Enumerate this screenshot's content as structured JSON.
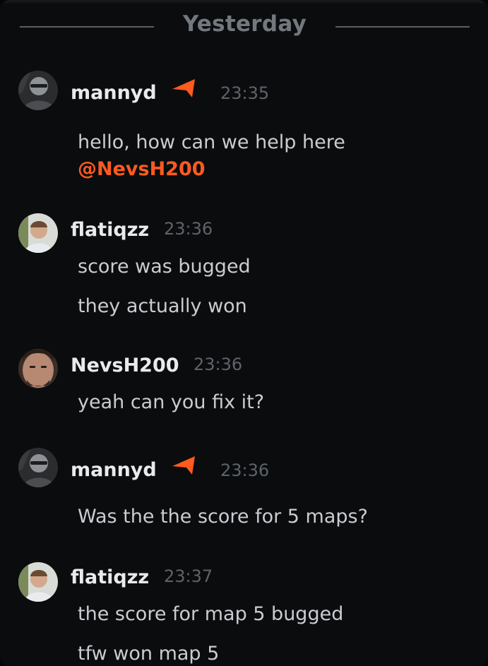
{
  "divider": {
    "label": "Yesterday"
  },
  "messages": [
    {
      "author": "mannyd",
      "badge": "moderator-flag-icon",
      "time": "23:35",
      "lines": [
        "hello, how can we help here"
      ],
      "mention": "@NevsH200"
    },
    {
      "author": "flatiqzz",
      "time": "23:36",
      "lines": [
        "score was bugged",
        "they actually won"
      ]
    },
    {
      "author": "NevsH200",
      "time": "23:36",
      "lines": [
        "yeah can you fix it?"
      ]
    },
    {
      "author": "mannyd",
      "badge": "moderator-flag-icon",
      "time": "23:36",
      "lines": [
        "Was the the score for 5 maps?"
      ]
    },
    {
      "author": "flatiqzz",
      "time": "23:37",
      "lines": [
        "the score for map 5 bugged",
        "tfw won map 5"
      ]
    }
  ],
  "colors": {
    "background": "#0b0c0e",
    "accent": "#ff5a1f",
    "text": "#c9cdd1",
    "author": "#e8ebed",
    "timestamp": "#5d636a"
  }
}
